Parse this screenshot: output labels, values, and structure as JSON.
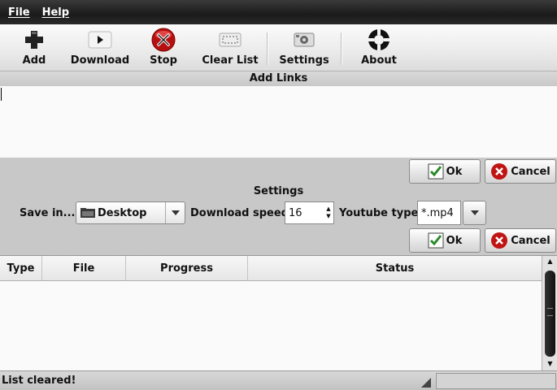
{
  "menu": {
    "file": "File",
    "help": "Help"
  },
  "toolbar": {
    "add": "Add",
    "download": "Download",
    "stop": "Stop",
    "clear_list": "Clear List",
    "settings": "Settings",
    "about": "About"
  },
  "add_links": {
    "title": "Add Links",
    "text": ""
  },
  "buttons": {
    "ok": "Ok",
    "cancel": "Cancel"
  },
  "settings": {
    "title": "Settings",
    "save_in_label": "Save in...",
    "save_in_value": "Desktop",
    "download_speed_label": "Download speed:",
    "download_speed_value": "16",
    "youtube_type_label": "Youtube type",
    "youtube_type_value": "*.mp4"
  },
  "table": {
    "columns": [
      "Type",
      "File",
      "Progress",
      "Status"
    ],
    "rows": []
  },
  "status": {
    "text": "List cleared!"
  },
  "colors": {
    "stop_red": "#d01818",
    "ok_check": "#2a8a2a",
    "menubar": "#1e1e1e"
  }
}
